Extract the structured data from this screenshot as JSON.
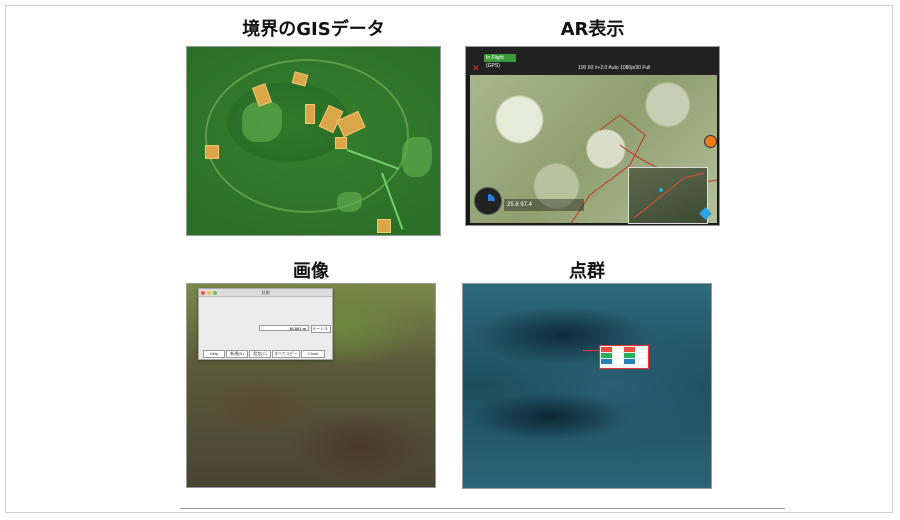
{
  "captions": {
    "gis": "境界のGISデータ",
    "ar": "AR表示",
    "image": "画像",
    "point_cloud": "点群"
  },
  "ar_ui": {
    "recording_label": "In Flight (GPS)",
    "params": "100   50   ±+2.0  Auto   1080p/30  Full",
    "hud_values": "25.8    97.4"
  },
  "image_dialog": {
    "title": "計測",
    "distance_value": "16.801 m",
    "unit": "メートル",
    "buttons": [
      "Help",
      "新規(N)",
      "設定(C)",
      "すべてコピー",
      "Close"
    ]
  },
  "colors": {
    "gis_patch": "#d9a64a",
    "gis_forest": "#2c6f28",
    "ar_marker": "#f07a1a",
    "pc_base": "#1d4e60",
    "measure_line": "#e33333"
  }
}
